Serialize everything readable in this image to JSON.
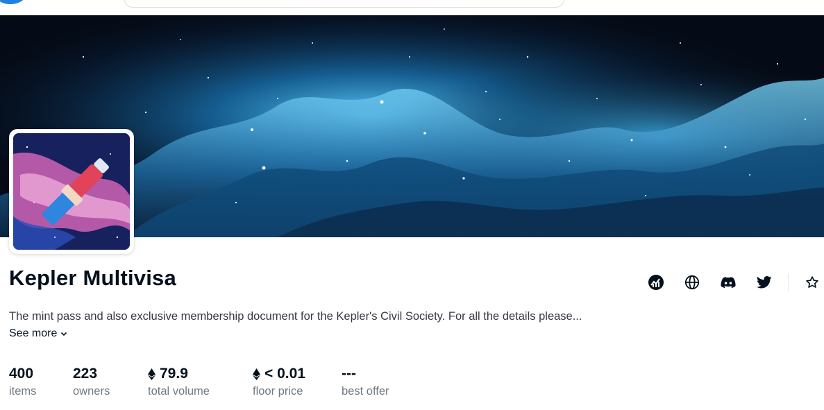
{
  "collection": {
    "name": "Kepler Multivisa",
    "description": "The mint pass and also exclusive membership document for the Kepler's Civil Society. For all the details please...",
    "see_more_label": "See more"
  },
  "social_icons": [
    "analytics-icon",
    "website-globe-icon",
    "discord-icon",
    "twitter-icon",
    "star-icon"
  ],
  "stats": [
    {
      "value": "400",
      "label": "items",
      "eth": false
    },
    {
      "value": "223",
      "label": "owners",
      "eth": false
    },
    {
      "value": "79.9",
      "label": "total volume",
      "eth": true
    },
    {
      "value": "< 0.01",
      "label": "floor price",
      "eth": true
    },
    {
      "value": "---",
      "label": "best offer",
      "eth": false
    }
  ],
  "colors": {
    "brand_blue": "#2081e2",
    "text_primary": "#04111d",
    "text_secondary": "#707a83",
    "text_body": "#353840"
  }
}
